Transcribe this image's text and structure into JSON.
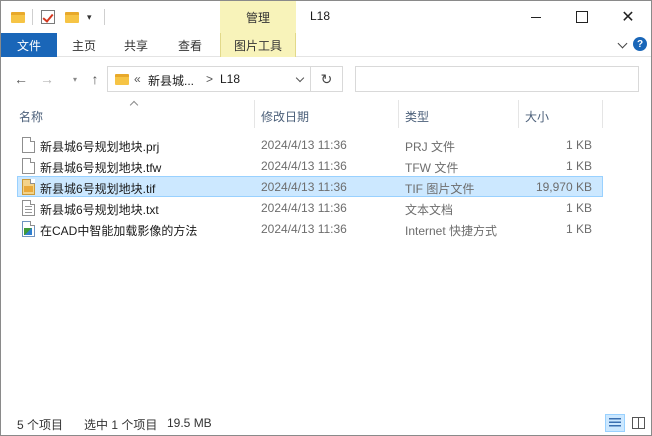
{
  "window": {
    "title": "L18",
    "contextual_group": "管理",
    "controls": {
      "minimize": "",
      "maximize": "",
      "close": "✕"
    }
  },
  "ribbon": {
    "tabs": [
      {
        "label": "文件",
        "active": true
      },
      {
        "label": "主页"
      },
      {
        "label": "共享"
      },
      {
        "label": "查看"
      },
      {
        "label": "图片工具"
      }
    ],
    "help_label": "?"
  },
  "navigation": {
    "back_icon": "←",
    "forward_icon": "→",
    "up_icon": "↑",
    "dropdown_icon": "▾",
    "breadcrumb": [
      "«",
      "新县城...",
      ">",
      "L18"
    ],
    "refresh_icon": "↻",
    "search_value": ""
  },
  "columns": [
    "名称",
    "修改日期",
    "类型",
    "大小"
  ],
  "files": [
    {
      "name": "新县城6号规划地块.prj",
      "date": "2024/4/13 11:36",
      "type": "PRJ 文件",
      "size": "1 KB",
      "icon": "document-icon",
      "selected": false
    },
    {
      "name": "新县城6号规划地块.tfw",
      "date": "2024/4/13 11:36",
      "type": "TFW 文件",
      "size": "1 KB",
      "icon": "document-icon",
      "selected": false
    },
    {
      "name": "新县城6号规划地块.tif",
      "date": "2024/4/13 11:36",
      "type": "TIF 图片文件",
      "size": "19,970 KB",
      "icon": "image-file-icon",
      "selected": true
    },
    {
      "name": "新县城6号规划地块.txt",
      "date": "2024/4/13 11:36",
      "type": "文本文档",
      "size": "1 KB",
      "icon": "text-file-icon",
      "selected": false
    },
    {
      "name": "在CAD中智能加载影像的方法",
      "date": "2024/4/13 11:36",
      "type": "Internet 快捷方式",
      "size": "1 KB",
      "icon": "internet-shortcut-icon",
      "selected": false
    }
  ],
  "status": {
    "item_count": "5 个项目",
    "selection": "选中 1 个项目",
    "selection_size": "19.5 MB"
  },
  "colors": {
    "file_tab": "#1a66b8",
    "contextual_tab": "#f8f3ba",
    "selection_bg": "#cce8ff",
    "selection_border": "#99d1ff",
    "header_text": "#4c607a"
  }
}
